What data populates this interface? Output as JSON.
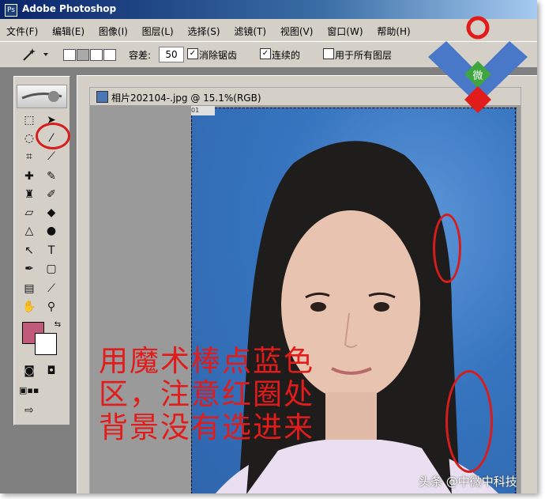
{
  "window": {
    "title": "Adobe Photoshop",
    "app_icon": "photoshop-icon"
  },
  "menu": [
    "文件(F)",
    "编辑(E)",
    "图像(I)",
    "图层(L)",
    "选择(S)",
    "滤镜(T)",
    "视图(V)",
    "窗口(W)",
    "帮助(H)"
  ],
  "options": {
    "tolerance_label": "容差:",
    "tolerance_value": "50",
    "antialias_label": "消除锯齿",
    "antialias_checked": true,
    "contiguous_label": "连续的",
    "contiguous_checked": true,
    "all_layers_label": "用于所有图层",
    "all_layers_checked": false
  },
  "document": {
    "title": "相片202104-.jpg @ 15.1%(RGB)",
    "ruler_stub": "01"
  },
  "annotation": {
    "lines": [
      "用魔术棒点蓝色",
      "区，注意红圈处",
      "背景没有选进来"
    ],
    "color": "#e21b1b"
  },
  "colors": {
    "foreground": "#c15a7a",
    "background": "#ffffff",
    "photo_bg": "#3674bf"
  },
  "watermark": {
    "logo_char": "微",
    "credit": "头条 @中微中科技"
  }
}
